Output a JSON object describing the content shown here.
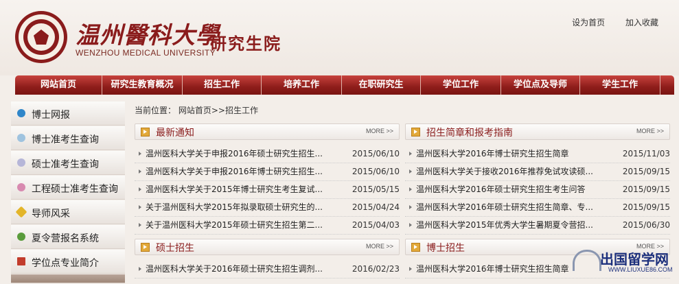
{
  "header": {
    "university_cn": "温州醫科大學",
    "university_en": "WENZHOU MEDICAL UNIVERSITY",
    "site_name": "研究生院",
    "links": [
      "设为首页",
      "加入收藏"
    ]
  },
  "nav": {
    "items": [
      "网站首页",
      "研究生教育概况",
      "招生工作",
      "培养工作",
      "在职研究生",
      "学位工作",
      "学位点及导师",
      "学生工作"
    ]
  },
  "sidebar": {
    "items": [
      {
        "label": "博士网报",
        "icon": "globe-icon",
        "color": "#2f86c9"
      },
      {
        "label": "博士准考生查询",
        "icon": "magnifier-icon",
        "color": "#9fc3df"
      },
      {
        "label": "硕士准考生查询",
        "icon": "magnifier-icon",
        "color": "#b6b6d8"
      },
      {
        "label": "工程硕士准考生查询",
        "icon": "magnifier-icon",
        "color": "#d88ab0"
      },
      {
        "label": "导师风采",
        "icon": "diamond-icon",
        "color": "#e3b52a"
      },
      {
        "label": "夏令营报名系统",
        "icon": "user-icon",
        "color": "#5a9c3c"
      },
      {
        "label": "学位点专业简介",
        "icon": "document-icon",
        "color": "#c23c2c"
      }
    ]
  },
  "breadcrumb": {
    "prefix": "当前位置：",
    "path": "网站首页>>招生工作"
  },
  "panels": {
    "latest": {
      "title": "最新通知",
      "more": "MORE >>",
      "rows": [
        {
          "text": "温州医科大学关于申报2016年硕士研究生招生...",
          "date": "2015/06/10"
        },
        {
          "text": "温州医科大学关于申报2016年博士研究生招生...",
          "date": "2015/06/10"
        },
        {
          "text": "温州医科大学关于2015年博士研究生考生复试...",
          "date": "2015/05/15"
        },
        {
          "text": "关于温州医科大学2015年拟录取硕士研究生的...",
          "date": "2015/04/24"
        },
        {
          "text": "关于温州医科大学2015年硕士研究生招生第二...",
          "date": "2015/04/03"
        }
      ]
    },
    "guide": {
      "title": "招生简章和报考指南",
      "more": "MORE >>",
      "rows": [
        {
          "text": "温州医科大学2016年博士研究生招生简章",
          "date": "2015/11/03"
        },
        {
          "text": "温州医科大学关于接收2016年推荐免试攻读硕...",
          "date": "2015/09/15"
        },
        {
          "text": "温州医科大学2016年硕士研究生招生考生问答",
          "date": "2015/09/15"
        },
        {
          "text": "温州医科大学2016年硕士研究生招生简章、专...",
          "date": "2015/09/15"
        },
        {
          "text": "温州医科大学2015年优秀大学生暑期夏令营招...",
          "date": "2015/06/30"
        }
      ]
    },
    "master": {
      "title": "硕士招生",
      "more": "MORE >>",
      "rows": [
        {
          "text": "温州医科大学关于2016年硕士研究生招生调剂...",
          "date": "2016/02/23"
        }
      ]
    },
    "phd": {
      "title": "博士招生",
      "more": "MORE >>",
      "rows": [
        {
          "text": "温州医科大学2016年博士研究生招生简章",
          "date": ""
        }
      ]
    }
  },
  "watermark": {
    "name": "出国留学网",
    "url": "WWW.LIUXUE86.COM"
  }
}
